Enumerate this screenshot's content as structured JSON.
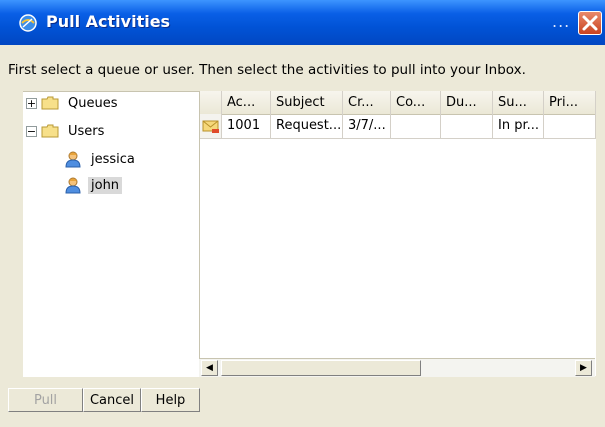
{
  "window": {
    "title": "Pull Activities",
    "title_overflow": "..."
  },
  "instructions": "First select a queue or user. Then select the activities to pull into your Inbox.",
  "tree": {
    "items": [
      {
        "label": "Queues",
        "expander": "+"
      },
      {
        "label": "Users",
        "expander": "−"
      },
      {
        "label": "jessica"
      },
      {
        "label": "john"
      }
    ]
  },
  "grid": {
    "columns": [
      "Ac...",
      "Subject",
      "Cr...",
      "Co...",
      "Du...",
      "Su...",
      "Pri..."
    ],
    "rows": [
      {
        "cells": [
          "1001",
          "Request...",
          "3/7/...",
          "",
          "",
          "In pr...",
          ""
        ]
      }
    ]
  },
  "scrollbar": {
    "left_arrow": "◀",
    "right_arrow": "▶"
  },
  "buttons": {
    "pull": "Pull",
    "cancel": "Cancel",
    "help": "Help"
  }
}
